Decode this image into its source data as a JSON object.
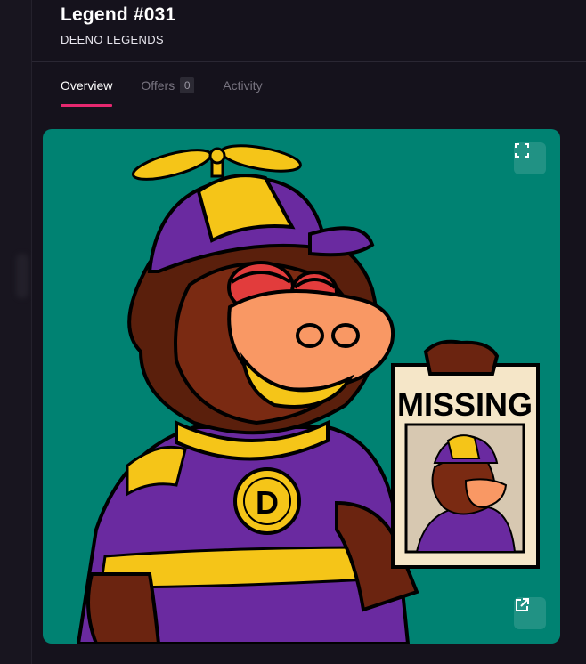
{
  "header": {
    "title": "Legend #031",
    "collection": "DEENO LEGENDS"
  },
  "tabs": [
    {
      "label": "Overview",
      "active": true
    },
    {
      "label": "Offers",
      "count": "0"
    },
    {
      "label": "Activity"
    }
  ],
  "artwork": {
    "poster_text": "MISSING",
    "medallion_letter": "D",
    "background_color": "#008272"
  },
  "controls": {
    "expand_icon": "fullscreen-icon",
    "open_icon": "external-link-icon"
  },
  "theme": {
    "accent": "#e5286f",
    "background": "#15121c"
  }
}
